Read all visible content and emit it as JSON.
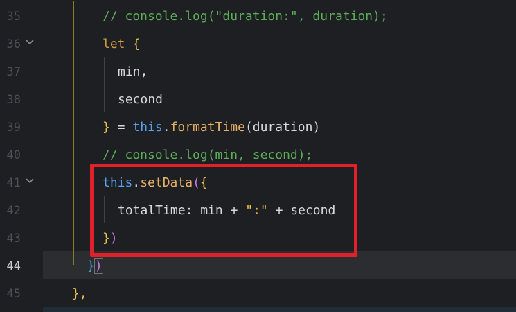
{
  "editor": {
    "current_line": 44,
    "lines": [
      {
        "number": "35",
        "tokens": [
          {
            "t": "// console.log(\"duration:\", duration);",
            "c": "tk-comment"
          }
        ]
      },
      {
        "number": "36",
        "tokens": [
          {
            "t": "let ",
            "c": "tk-kw"
          },
          {
            "t": "{",
            "c": "tk-brace-y"
          }
        ]
      },
      {
        "number": "37",
        "tokens": [
          {
            "t": "min,",
            "c": "tk-plain"
          }
        ]
      },
      {
        "number": "38",
        "tokens": [
          {
            "t": "second",
            "c": "tk-plain"
          }
        ]
      },
      {
        "number": "39",
        "tokens": [
          {
            "t": "}",
            "c": "tk-brace-y"
          },
          {
            "t": " = ",
            "c": "tk-op"
          },
          {
            "t": "this",
            "c": "tk-this"
          },
          {
            "t": ".",
            "c": "tk-op"
          },
          {
            "t": "formatTime",
            "c": "tk-method"
          },
          {
            "t": "(duration)",
            "c": "tk-plain"
          }
        ]
      },
      {
        "number": "40",
        "tokens": [
          {
            "t": "// console.log(min, second);",
            "c": "tk-comment"
          }
        ]
      },
      {
        "number": "41",
        "tokens": [
          {
            "t": "this",
            "c": "tk-this"
          },
          {
            "t": ".",
            "c": "tk-op"
          },
          {
            "t": "setData",
            "c": "tk-method"
          },
          {
            "t": "(",
            "c": "tk-brace-p"
          },
          {
            "t": "{",
            "c": "tk-brace-y"
          }
        ]
      },
      {
        "number": "42",
        "tokens": [
          {
            "t": "totalTime",
            "c": "tk-prop"
          },
          {
            "t": ": min + ",
            "c": "tk-op"
          },
          {
            "t": "\":\"",
            "c": "tk-string"
          },
          {
            "t": " + second",
            "c": "tk-op"
          }
        ]
      },
      {
        "number": "43",
        "tokens": [
          {
            "t": "}",
            "c": "tk-brace-y"
          },
          {
            "t": ")",
            "c": "tk-brace-p"
          }
        ]
      },
      {
        "number": "44",
        "tokens": [
          {
            "t": "}",
            "c": "tk-brace-b"
          },
          {
            "t": ")",
            "c": "tk-brace-p"
          }
        ]
      },
      {
        "number": "45",
        "tokens": [
          {
            "t": "},",
            "c": "tk-brace-y"
          }
        ]
      }
    ]
  },
  "colors": {
    "background": "#1e1f22",
    "highlight_box": "#e0202a",
    "current_line_bg": "#2b2d30"
  }
}
